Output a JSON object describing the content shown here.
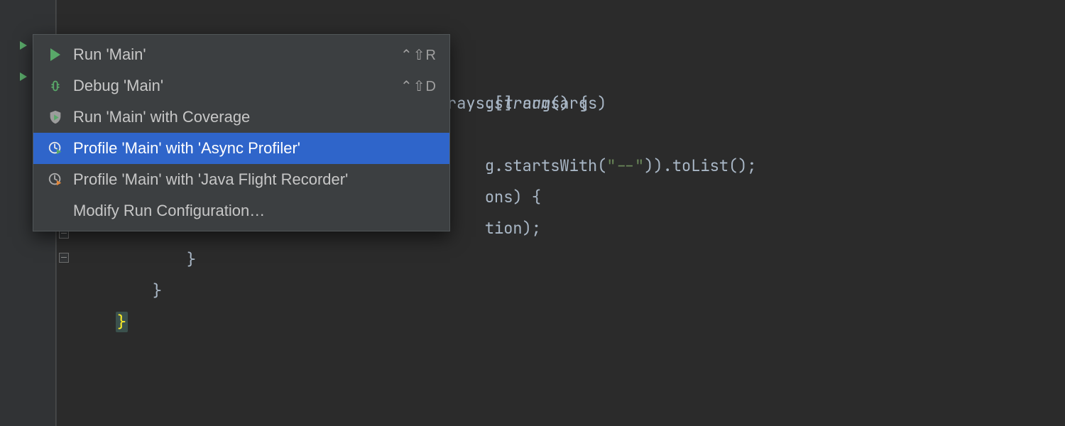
{
  "menu": {
    "items": [
      {
        "icon": "play",
        "label": "Run 'Main'",
        "shortcut": "⌃⇧R",
        "selected": false
      },
      {
        "icon": "bug",
        "label": "Debug 'Main'",
        "shortcut": "⌃⇧D",
        "selected": false
      },
      {
        "icon": "shield-play",
        "label": "Run 'Main' with Coverage",
        "shortcut": "",
        "selected": false
      },
      {
        "icon": "clock-play",
        "label": "Profile 'Main' with 'Async Profiler'",
        "shortcut": "",
        "selected": true
      },
      {
        "icon": "clock-play-alt",
        "label": "Profile 'Main' with 'Java Flight Recorder'",
        "shortcut": "",
        "selected": false
      },
      {
        "icon": "",
        "label": "Modify Run Configuration…",
        "shortcut": "",
        "selected": false
      }
    ]
  },
  "code": {
    "line1_a": "g[] args) {",
    "line2_a": "rays.",
    "line2_b": "stream",
    "line2_c": "(args)",
    "line3_a": "g.startsWith(",
    "line3_b": "\"--\"",
    "line3_c": ")).toList();",
    "line4_a": "ons) {",
    "line5_a": "tion);",
    "line6_a": "}",
    "line7_a": "}",
    "line8_a": "}"
  }
}
